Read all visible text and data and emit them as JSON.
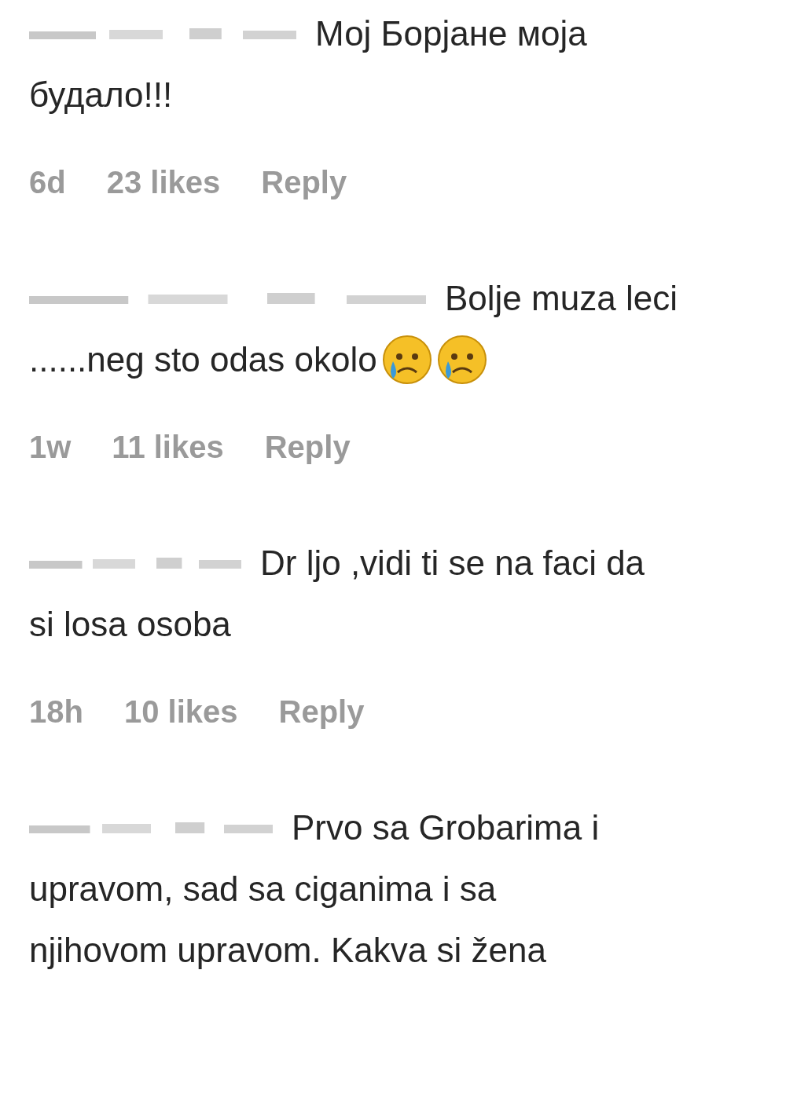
{
  "comments": [
    {
      "lines": [
        "Мој Борјане моја",
        "будало!!!"
      ],
      "time": "6d",
      "likes": "23 likes",
      "reply": "Reply"
    },
    {
      "lines": [
        "Bolje muza leci",
        "......neg sto odas okolo"
      ],
      "emojis": [
        {
          "kind": "crying"
        },
        {
          "kind": "crying"
        }
      ],
      "time": "1w",
      "likes": "11 likes",
      "reply": "Reply"
    },
    {
      "lines": [
        "Dr  ljo ,vidi ti se na faci da",
        "si losa osoba"
      ],
      "time": "18h",
      "likes": "10 likes",
      "reply": "Reply"
    },
    {
      "lines": [
        "Prvo sa Grobarima i",
        "upravom, sad sa ciganima i sa",
        "njihovom upravom. Kakva si žena"
      ]
    }
  ]
}
